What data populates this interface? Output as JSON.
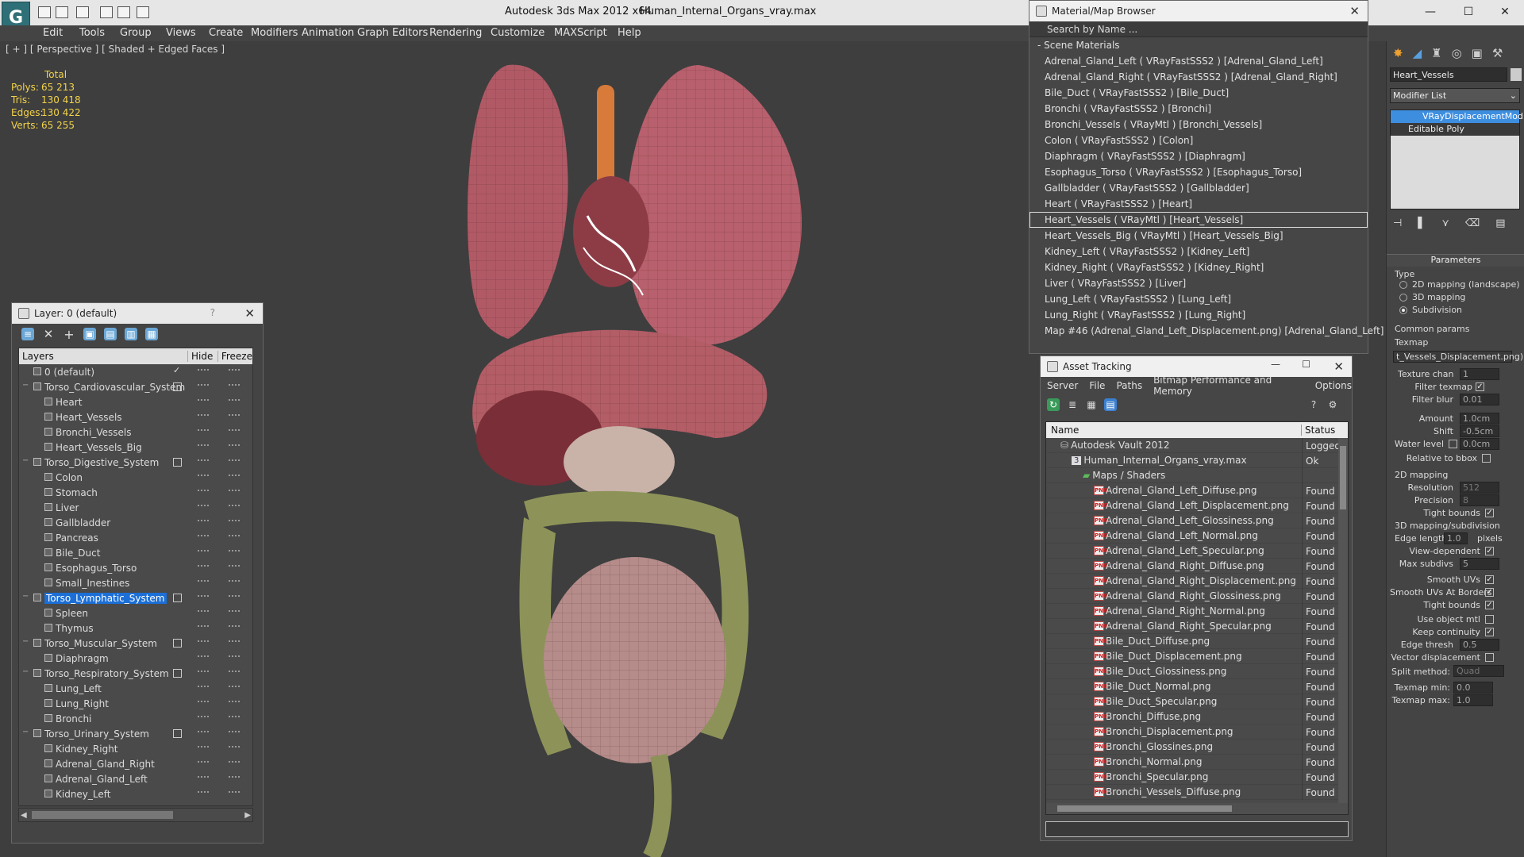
{
  "app": {
    "title": "Autodesk 3ds Max  2012 x64",
    "file": "Human_Internal_Organs_vray.max"
  },
  "menu": [
    "Edit",
    "Tools",
    "Group",
    "Views",
    "Create",
    "Modifiers",
    "Animation",
    "Graph Editors",
    "Rendering",
    "Customize",
    "MAXScript",
    "Help"
  ],
  "viewport": {
    "label": "[ + ] [ Perspective ] [ Shaded + Edged Faces ]",
    "stats_header": "Total",
    "stats": [
      {
        "k": "Polys:",
        "v": "65 213"
      },
      {
        "k": "Tris:",
        "v": "130 418"
      },
      {
        "k": "Edges:",
        "v": "130 422"
      },
      {
        "k": "Verts:",
        "v": "65 255"
      }
    ]
  },
  "layers": {
    "title": "Layer: 0 (default)",
    "help": "?",
    "col_layers": "Layers",
    "col_hide": "Hide",
    "col_freeze": "Freeze",
    "rows": [
      {
        "name": "0 (default)",
        "level": 0
      },
      {
        "name": "Torso_Cardiovascular_System",
        "level": 0
      },
      {
        "name": "Heart",
        "level": 1
      },
      {
        "name": "Heart_Vessels",
        "level": 1
      },
      {
        "name": "Bronchi_Vessels",
        "level": 1
      },
      {
        "name": "Heart_Vessels_Big",
        "level": 1
      },
      {
        "name": "Torso_Digestive_System",
        "level": 0
      },
      {
        "name": "Colon",
        "level": 1
      },
      {
        "name": "Stomach",
        "level": 1
      },
      {
        "name": "Liver",
        "level": 1
      },
      {
        "name": "Gallbladder",
        "level": 1
      },
      {
        "name": "Pancreas",
        "level": 1
      },
      {
        "name": "Bile_Duct",
        "level": 1
      },
      {
        "name": "Esophagus_Torso",
        "level": 1
      },
      {
        "name": "Small_Inestines",
        "level": 1
      },
      {
        "name": "Torso_Lymphatic_System",
        "level": 0
      },
      {
        "name": "Spleen",
        "level": 1
      },
      {
        "name": "Thymus",
        "level": 1
      },
      {
        "name": "Torso_Muscular_System",
        "level": 0
      },
      {
        "name": "Diaphragm",
        "level": 1
      },
      {
        "name": "Torso_Respiratory_System",
        "level": 0
      },
      {
        "name": "Lung_Left",
        "level": 1
      },
      {
        "name": "Lung_Right",
        "level": 1
      },
      {
        "name": "Bronchi",
        "level": 1
      },
      {
        "name": "Torso_Urinary_System",
        "level": 0
      },
      {
        "name": "Kidney_Right",
        "level": 1
      },
      {
        "name": "Adrenal_Gland_Right",
        "level": 1
      },
      {
        "name": "Adrenal_Gland_Left",
        "level": 1
      },
      {
        "name": "Kidney_Left",
        "level": 1
      }
    ]
  },
  "material_browser": {
    "title": "Material/Map Browser",
    "search_placeholder": "Search by Name ...",
    "section": "- Scene Materials",
    "items": [
      "Adrenal_Gland_Left  ( VRayFastSSS2 ) [Adrenal_Gland_Left]",
      "Adrenal_Gland_Right  ( VRayFastSSS2 ) [Adrenal_Gland_Right]",
      "Bile_Duct  ( VRayFastSSS2 ) [Bile_Duct]",
      "Bronchi  ( VRayFastSSS2 ) [Bronchi]",
      "Bronchi_Vessels  ( VRayMtl ) [Bronchi_Vessels]",
      "Colon  ( VRayFastSSS2 ) [Colon]",
      "Diaphragm  ( VRayFastSSS2 ) [Diaphragm]",
      "Esophagus_Torso  ( VRayFastSSS2 ) [Esophagus_Torso]",
      "Gallbladder  ( VRayFastSSS2 ) [Gallbladder]",
      "Heart  ( VRayFastSSS2 ) [Heart]",
      "Heart_Vessels  ( VRayMtl ) [Heart_Vessels]",
      "Heart_Vessels_Big  ( VRayMtl ) [Heart_Vessels_Big]",
      "Kidney_Left  ( VRayFastSSS2 ) [Kidney_Left]",
      "Kidney_Right  ( VRayFastSSS2 ) [Kidney_Right]",
      "Liver  ( VRayFastSSS2 ) [Liver]",
      "Lung_Left  ( VRayFastSSS2 ) [Lung_Left]",
      "Lung_Right  ( VRayFastSSS2 ) [Lung_Right]",
      "Map #46 (Adrenal_Gland_Left_Displacement.png) [Adrenal_Gland_Left]"
    ]
  },
  "asset_tracking": {
    "title": "Asset Tracking",
    "menu": [
      "Server",
      "File",
      "Paths",
      "Bitmap Performance and Memory",
      "Options"
    ],
    "col_name": "Name",
    "col_status": "Status",
    "rows": [
      {
        "name": "Autodesk Vault 2012",
        "status": "Logged O",
        "indent": 1,
        "icon": "vault"
      },
      {
        "name": "Human_Internal_Organs_vray.max",
        "status": "Ok",
        "indent": 2,
        "icon": "max"
      },
      {
        "name": "Maps / Shaders",
        "status": "",
        "indent": 3,
        "icon": "folder"
      },
      {
        "name": "Adrenal_Gland_Left_Diffuse.png",
        "status": "Found",
        "indent": 4,
        "icon": "png"
      },
      {
        "name": "Adrenal_Gland_Left_Displacement.png",
        "status": "Found",
        "indent": 4,
        "icon": "png"
      },
      {
        "name": "Adrenal_Gland_Left_Glossiness.png",
        "status": "Found",
        "indent": 4,
        "icon": "png"
      },
      {
        "name": "Adrenal_Gland_Left_Normal.png",
        "status": "Found",
        "indent": 4,
        "icon": "png"
      },
      {
        "name": "Adrenal_Gland_Left_Specular.png",
        "status": "Found",
        "indent": 4,
        "icon": "png"
      },
      {
        "name": "Adrenal_Gland_Right_Diffuse.png",
        "status": "Found",
        "indent": 4,
        "icon": "png"
      },
      {
        "name": "Adrenal_Gland_Right_Displacement.png",
        "status": "Found",
        "indent": 4,
        "icon": "png"
      },
      {
        "name": "Adrenal_Gland_Right_Glossiness.png",
        "status": "Found",
        "indent": 4,
        "icon": "png"
      },
      {
        "name": "Adrenal_Gland_Right_Normal.png",
        "status": "Found",
        "indent": 4,
        "icon": "png"
      },
      {
        "name": "Adrenal_Gland_Right_Specular.png",
        "status": "Found",
        "indent": 4,
        "icon": "png"
      },
      {
        "name": "Bile_Duct_Diffuse.png",
        "status": "Found",
        "indent": 4,
        "icon": "png"
      },
      {
        "name": "Bile_Duct_Displacement.png",
        "status": "Found",
        "indent": 4,
        "icon": "png"
      },
      {
        "name": "Bile_Duct_Glossiness.png",
        "status": "Found",
        "indent": 4,
        "icon": "png"
      },
      {
        "name": "Bile_Duct_Normal.png",
        "status": "Found",
        "indent": 4,
        "icon": "png"
      },
      {
        "name": "Bile_Duct_Specular.png",
        "status": "Found",
        "indent": 4,
        "icon": "png"
      },
      {
        "name": "Bronchi_Diffuse.png",
        "status": "Found",
        "indent": 4,
        "icon": "png"
      },
      {
        "name": "Bronchi_Displacement.png",
        "status": "Found",
        "indent": 4,
        "icon": "png"
      },
      {
        "name": "Bronchi_Glossines.png",
        "status": "Found",
        "indent": 4,
        "icon": "png"
      },
      {
        "name": "Bronchi_Normal.png",
        "status": "Found",
        "indent": 4,
        "icon": "png"
      },
      {
        "name": "Bronchi_Specular.png",
        "status": "Found",
        "indent": 4,
        "icon": "png"
      },
      {
        "name": "Bronchi_Vessels_Diffuse.png",
        "status": "Found",
        "indent": 4,
        "icon": "png"
      }
    ]
  },
  "command_panel": {
    "object_name": "Heart_Vessels",
    "modifier_list": "Modifier List",
    "stack": [
      "VRayDisplacementMod",
      "Editable Poly"
    ],
    "parameters": "Parameters",
    "type_label": "Type",
    "type_opts": [
      "2D mapping (landscape)",
      "3D mapping",
      "Subdivision"
    ],
    "common": "Common params",
    "texmap": "Texmap",
    "texmap_val": "t_Vessels_Displacement.png)",
    "texture_chan": "Texture chan",
    "texture_chan_v": "1",
    "filter_texmap": "Filter texmap",
    "filter_blur": "Filter blur",
    "filter_blur_v": "0.01",
    "amount": "Amount",
    "amount_v": "1.0cm",
    "shift": "Shift",
    "shift_v": "-0.5cm",
    "water": "Water level",
    "water_v": "0.0cm",
    "relbbox": "Relative to bbox",
    "sec2d": "2D mapping",
    "resolution": "Resolution",
    "resolution_v": "512",
    "precision": "Precision",
    "precision_v": "8",
    "tight1": "Tight bounds",
    "sec3d": "3D mapping/subdivision",
    "edge_len": "Edge length",
    "edge_len_v": "1.0",
    "pixels": "pixels",
    "view_dep": "View-dependent",
    "max_subdivs": "Max subdivs",
    "max_subdivs_v": "5",
    "smooth_uv": "Smooth UVs",
    "smooth_uv_b": "Smooth UVs At Borders",
    "tight2": "Tight bounds",
    "use_obj": "Use object mtl",
    "keep": "Keep continuity",
    "edge_thresh": "Edge thresh",
    "edge_thresh_v": "0.5",
    "vec_disp": "Vector displacement",
    "split": "Split method:",
    "split_v": "Quad",
    "tex_min": "Texmap min:",
    "tex_min_v": "0.0",
    "tex_max": "Texmap max:",
    "tex_max_v": "1.0"
  }
}
